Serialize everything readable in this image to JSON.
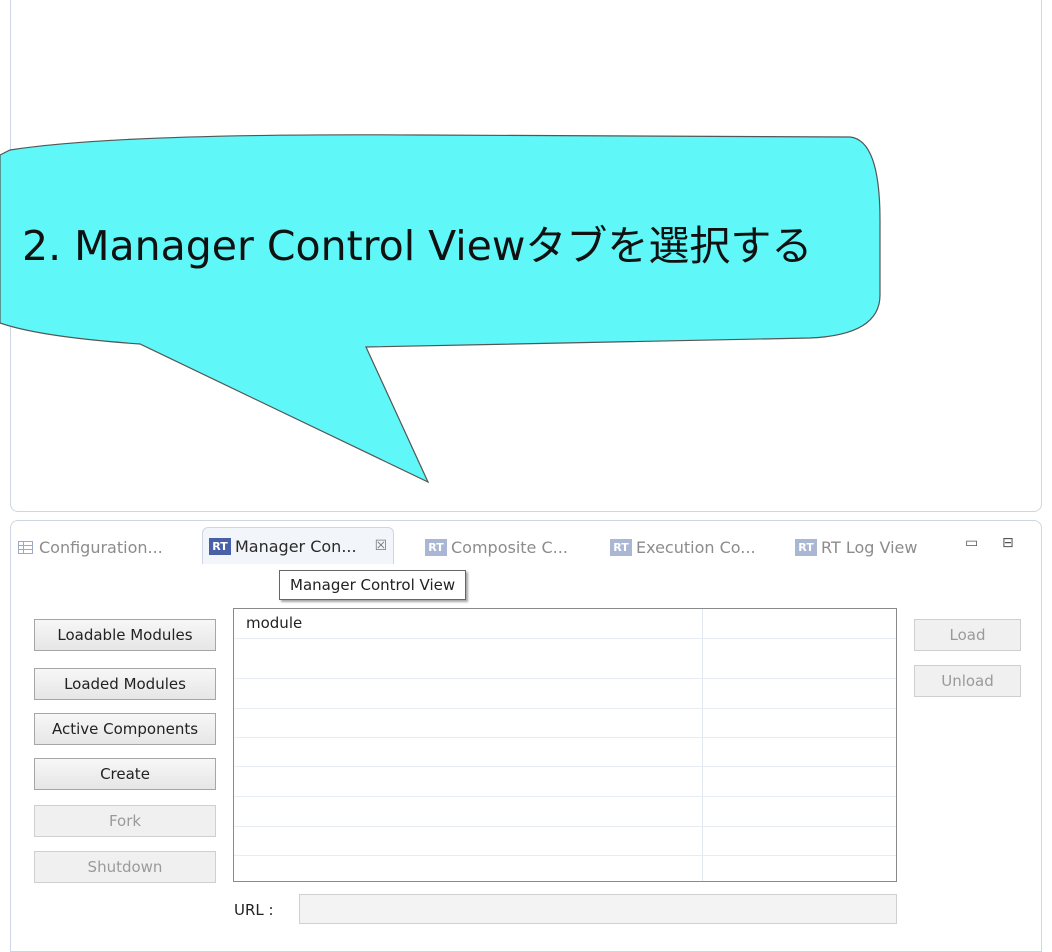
{
  "annotation": {
    "text": "2. Manager Control Viewタブを選択する",
    "fill_color": "#5ff7f7"
  },
  "tabs": [
    {
      "label": "Configuration...",
      "icon": "table-icon",
      "active": false
    },
    {
      "label": "Manager Con...",
      "icon": "rt-icon",
      "active": true
    },
    {
      "label": "Composite C...",
      "icon": "rt-icon",
      "active": false
    },
    {
      "label": "Execution Co...",
      "icon": "rt-icon",
      "active": false
    },
    {
      "label": "RT Log View",
      "icon": "rt-icon",
      "active": false
    }
  ],
  "rt_icon_text": "RT",
  "close_glyph": "☒",
  "window_controls": {
    "minimize": "▭",
    "maximize": "⊟"
  },
  "tooltip": "Manager Control View",
  "left_buttons": [
    {
      "label": "Loadable Modules",
      "enabled": true
    },
    {
      "label": "Loaded Modules",
      "enabled": true
    },
    {
      "label": "Active Components",
      "enabled": true
    },
    {
      "label": "Create",
      "enabled": true
    },
    {
      "label": "Fork",
      "enabled": false
    },
    {
      "label": "Shutdown",
      "enabled": false
    }
  ],
  "right_buttons": [
    {
      "label": "Load",
      "enabled": false
    },
    {
      "label": "Unload",
      "enabled": false
    }
  ],
  "table": {
    "header": "module",
    "rows": [
      "",
      "",
      "",
      "",
      "",
      "",
      "",
      ""
    ]
  },
  "url": {
    "label": "URL :",
    "value": ""
  }
}
